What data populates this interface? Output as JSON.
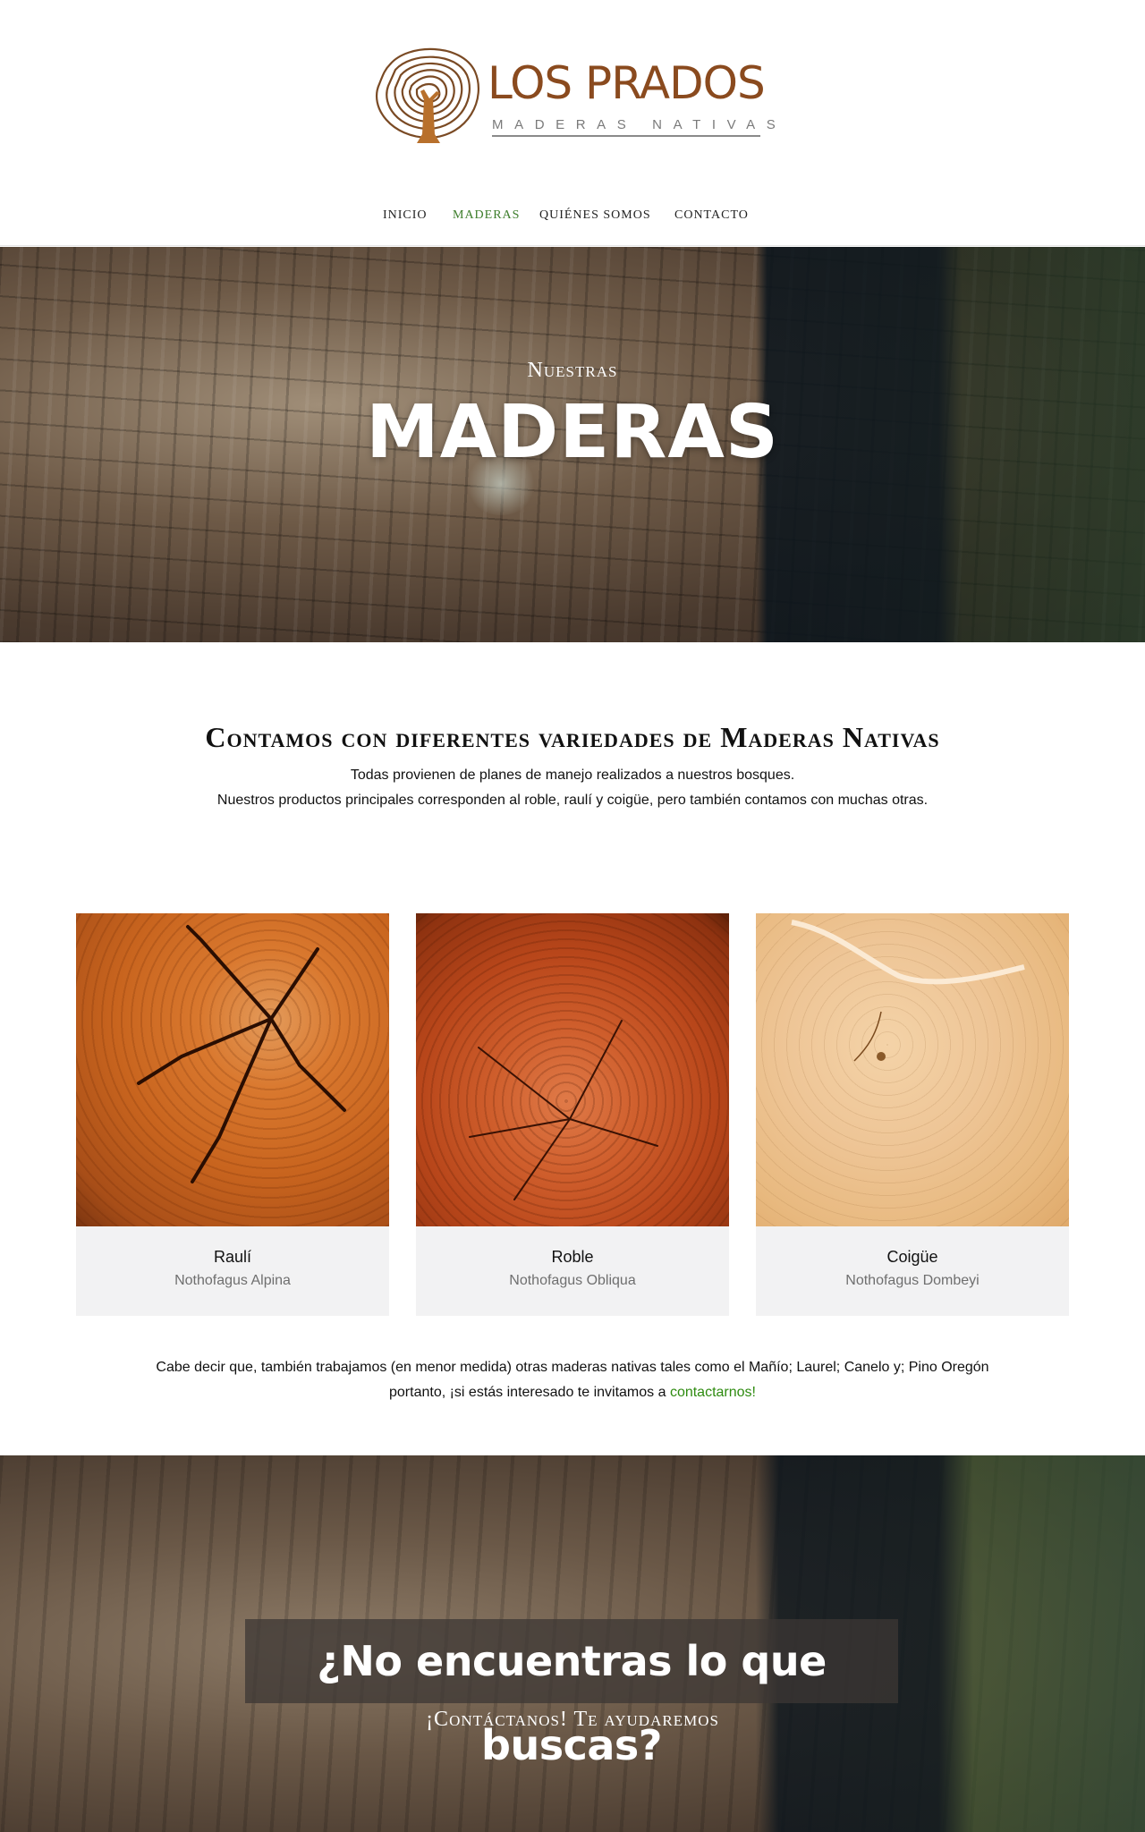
{
  "brand": {
    "name": "LOS PRADOS",
    "tagline": "MADERAS NATIVAS",
    "colors": {
      "brown": "#8a4a1e",
      "green": "#3c7d2a"
    }
  },
  "nav": {
    "items": [
      {
        "label": "INICIO",
        "active": false
      },
      {
        "label": "MADERAS",
        "active": true
      },
      {
        "label": "QUIÉNES SOMOS",
        "active": false
      },
      {
        "label": "CONTACTO",
        "active": false
      }
    ]
  },
  "hero": {
    "kicker": "Nuestras",
    "title": "MADERAS"
  },
  "intro": {
    "heading": "Contamos con diferentes variedades de Maderas Nativas",
    "line1": "Todas provienen de planes de manejo realizados a nuestros bosques.",
    "line2": "Nuestros productos principales corresponden al roble, raulí y coigüe, pero también contamos con muchas otras."
  },
  "woods": [
    {
      "name": "Raulí",
      "scientific": "Nothofagus Alpina"
    },
    {
      "name": "Roble",
      "scientific": "Nothofagus Obliqua"
    },
    {
      "name": "Coigüe",
      "scientific": "Nothofagus Dombeyi"
    }
  ],
  "note": {
    "line1": "Cabe decir que, también trabajamos (en menor medida) otras maderas nativas tales como el Mañío; Laurel; Canelo y; Pino Oregón",
    "line2_prefix": "portanto, ¡si estás interesado te invitamos a ",
    "link": "contactarnos!"
  },
  "cta": {
    "title": "¿No encuentras lo que buscas?",
    "subtitle": "¡Contáctanos! Te ayudaremos"
  }
}
